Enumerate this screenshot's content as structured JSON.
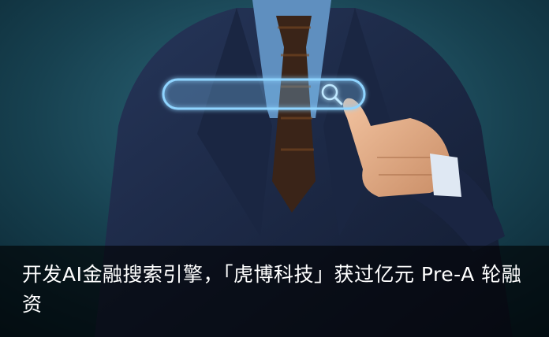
{
  "article": {
    "headline": "开发AI金融搜索引擎，「虎博科技」获过亿元 Pre-A 轮融资"
  },
  "image": {
    "subject": "businessman in dark suit pointing at a glowing search bar",
    "icons": [
      "search-icon"
    ],
    "colors": {
      "background": "#0c2a36",
      "suit": "#1e2d48",
      "search_bar_glow": "#7ec8ff",
      "caption_overlay": "#000000"
    }
  }
}
